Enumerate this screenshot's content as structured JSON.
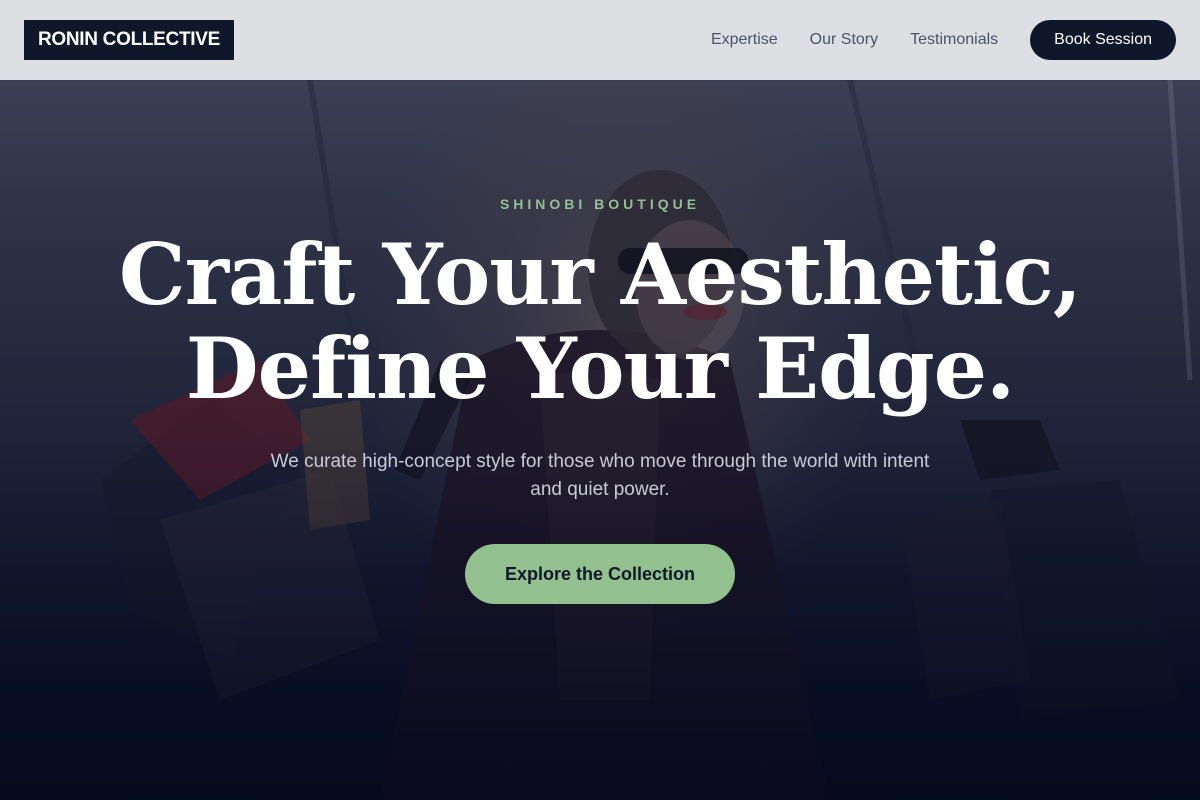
{
  "header": {
    "logo_text": "RONIN COLLECTIVE",
    "nav": [
      {
        "label": "Expertise"
      },
      {
        "label": "Our Story"
      },
      {
        "label": "Testimonials"
      }
    ],
    "cta_label": "Book Session"
  },
  "hero": {
    "eyebrow": "SHINOBI BOUTIQUE",
    "headline_line1": "Craft Your Aesthetic,",
    "headline_line2": "Define Your Edge.",
    "subheadline": "We curate high-concept style for those who move through the world with intent and quiet power.",
    "cta_label": "Explore the Collection"
  },
  "colors": {
    "brand_dark": "#0f172a",
    "accent_green": "#93c08f",
    "nav_text": "#475569",
    "hero_bg_bottom": "#080c22"
  }
}
